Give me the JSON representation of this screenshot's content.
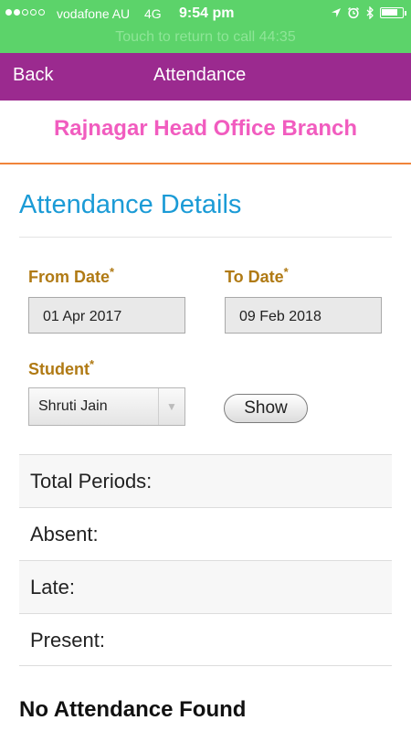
{
  "status_bar": {
    "carrier": "vodafone AU",
    "network": "4G",
    "time": "9:54 pm",
    "call_banner": "Touch to return to call 44:35",
    "battery_level": 0.85,
    "icons": [
      "location-arrow-icon",
      "alarm-clock-icon",
      "bluetooth-icon",
      "battery-icon"
    ]
  },
  "nav": {
    "back_label": "Back",
    "title": "Attendance"
  },
  "branch": {
    "name": "Rajnagar Head Office Branch"
  },
  "section": {
    "title": "Attendance Details"
  },
  "form": {
    "from_date": {
      "label": "From Date",
      "required": "*",
      "value": "01 Apr 2017"
    },
    "to_date": {
      "label": "To Date",
      "required": "*",
      "value": "09 Feb 2018"
    },
    "student": {
      "label": "Student",
      "required": "*",
      "value": "Shruti Jain"
    },
    "show_label": "Show"
  },
  "stats": [
    {
      "label": "Total Periods:"
    },
    {
      "label": "Absent:"
    },
    {
      "label": "Late:"
    },
    {
      "label": "Present:"
    }
  ],
  "message": "No Attendance Found",
  "colors": {
    "status_bar": "#5cd36a",
    "nav_bar": "#9b2a8f",
    "branch_text": "#f15cbf",
    "branch_rule": "#f0843a",
    "section_title": "#1b9bd6",
    "field_label": "#b07a14"
  }
}
